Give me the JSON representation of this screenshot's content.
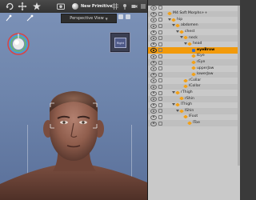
{
  "toolbar": {
    "new_primitive_label": "New Primitive",
    "icons": [
      "rotate-tool-icon",
      "universal-tool-icon",
      "star-tool-icon",
      "render-icon",
      "primitive-dot-icon"
    ]
  },
  "viewport": {
    "camera_label": "Perspective View",
    "cube_face_label": "Right",
    "background_color": "#7289b0"
  },
  "scene": {
    "rows": [
      {
        "label": "",
        "depth": 0,
        "twisty": false,
        "icon": "none"
      },
      {
        "label": "M4 Soft Morphs++",
        "depth": 1,
        "twisty": false,
        "icon": "node"
      },
      {
        "label": "hip",
        "depth": 2,
        "twisty": true,
        "icon": "node"
      },
      {
        "label": "abdomen",
        "depth": 3,
        "twisty": true,
        "icon": "node"
      },
      {
        "label": "chest",
        "depth": 4,
        "twisty": true,
        "icon": "node"
      },
      {
        "label": "neck",
        "depth": 5,
        "twisty": true,
        "icon": "node"
      },
      {
        "label": "head",
        "depth": 6,
        "twisty": true,
        "icon": "node"
      },
      {
        "label": "eyeBrow",
        "depth": 7,
        "twisty": false,
        "icon": "fig",
        "selected": true
      },
      {
        "label": "lEye",
        "depth": 7,
        "twisty": false,
        "icon": "node"
      },
      {
        "label": "rEye",
        "depth": 7,
        "twisty": false,
        "icon": "node"
      },
      {
        "label": "upperJaw",
        "depth": 7,
        "twisty": false,
        "icon": "node"
      },
      {
        "label": "lowerJaw",
        "depth": 7,
        "twisty": false,
        "icon": "node"
      },
      {
        "label": "rCollar",
        "depth": 5,
        "twisty": false,
        "icon": "node"
      },
      {
        "label": "lCollar",
        "depth": 5,
        "twisty": false,
        "icon": "node"
      },
      {
        "label": "rThigh",
        "depth": 3,
        "twisty": true,
        "icon": "node"
      },
      {
        "label": "rShin",
        "depth": 4,
        "twisty": false,
        "icon": "node"
      },
      {
        "label": "lThigh",
        "depth": 3,
        "twisty": true,
        "icon": "node"
      },
      {
        "label": "lShin",
        "depth": 4,
        "twisty": true,
        "icon": "node"
      },
      {
        "label": "lFoot",
        "depth": 5,
        "twisty": false,
        "icon": "node"
      },
      {
        "label": "lToe",
        "depth": 6,
        "twisty": false,
        "icon": "node"
      }
    ]
  }
}
